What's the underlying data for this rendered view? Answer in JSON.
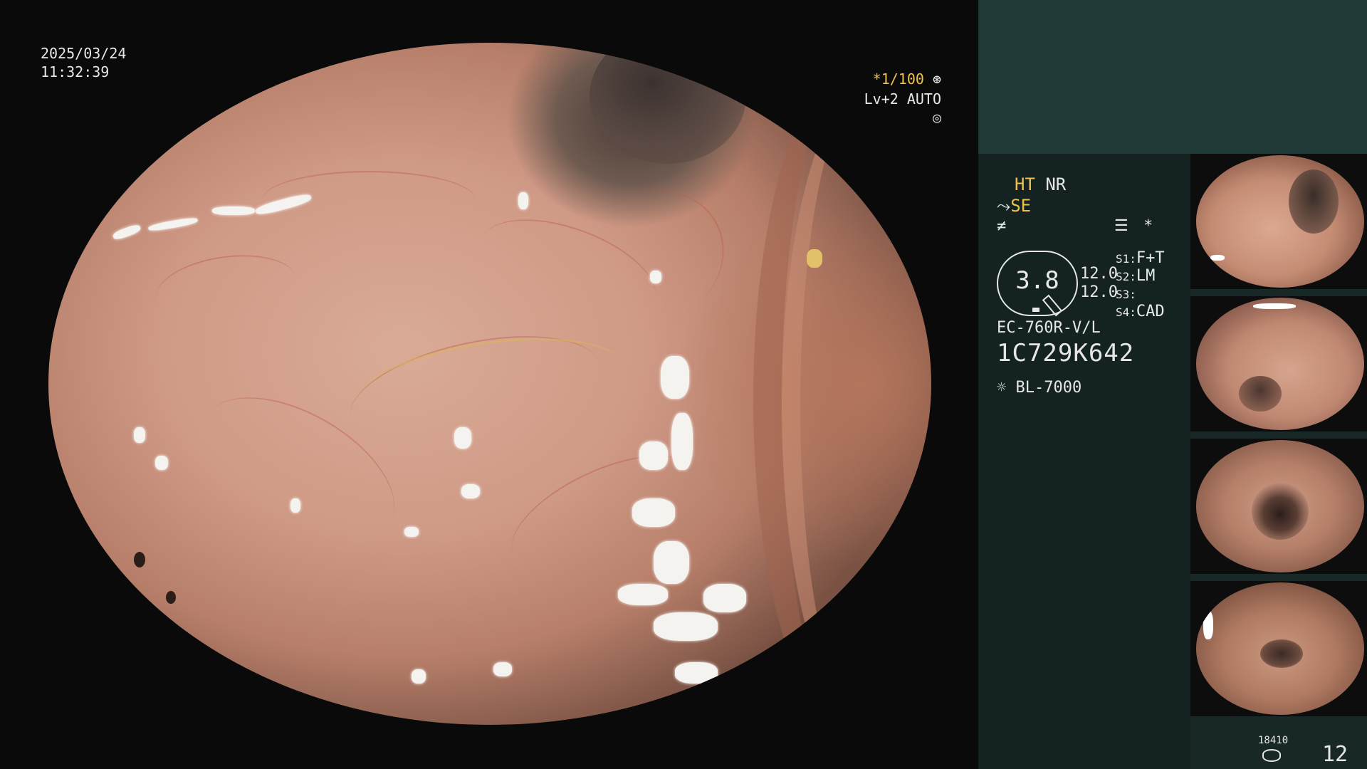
{
  "main_view": {
    "date": "2025/03/24",
    "time": "11:32:39",
    "shutter_value": "*1/100",
    "shutter_icon": "aperture-icon",
    "level_text": "Lv+2 AUTO",
    "auto_icon": "auto-exposure-icon"
  },
  "info_panel": {
    "ht_label": "HT",
    "nr_label": "NR",
    "se_label": "SE",
    "se_icon": "structure-enhance-icon",
    "freq_icon": "frequency-icon",
    "menu_icon": "menu-list-icon",
    "asterisk": "*",
    "gauge_value": "3.8",
    "value_a": "12.0",
    "value_b": "12.0",
    "slots": [
      {
        "key": "S1",
        "value": "F+T"
      },
      {
        "key": "S2",
        "value": "LM"
      },
      {
        "key": "S3",
        "value": ""
      },
      {
        "key": "S4",
        "value": "CAD"
      }
    ],
    "scope_model": "EC-760R-V/L",
    "serial_number": "1C729K642",
    "light_source": "BL-7000",
    "light_icon": "sun-icon",
    "image_count_small": "18410",
    "image_count_big": "12",
    "storage_icon": "storage-disk-icon"
  },
  "colors": {
    "accent_yellow": "#f0c24a",
    "panel_bg": "#182826",
    "panel_top_bg": "#1f3a36"
  }
}
